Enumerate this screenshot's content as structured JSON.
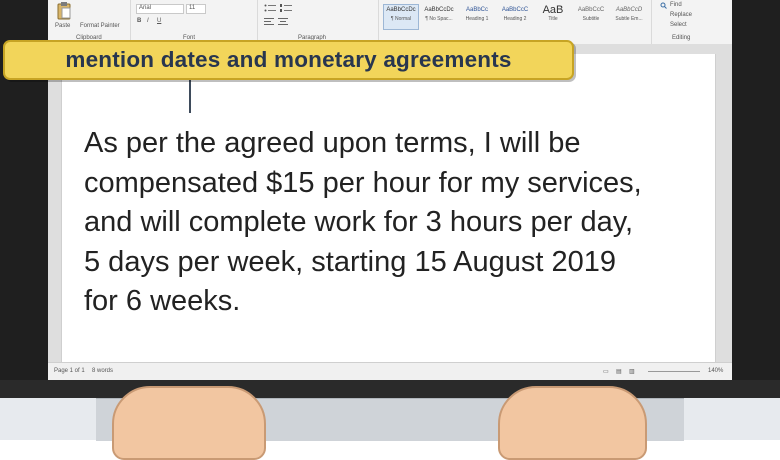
{
  "annotation": {
    "text": "mention dates and monetary agreements"
  },
  "document": {
    "body_lines": [
      "As per the agreed upon terms, I will be",
      "compensated $15 per hour for my services,",
      "and will complete work for 3 hours per day,",
      "5 days per week, starting 15 August 2019",
      "for 6 weeks."
    ]
  },
  "ribbon": {
    "clipboard": {
      "paste": "Paste",
      "format_painter": "Format Painter",
      "group": "Clipboard"
    },
    "font": {
      "name": "Arial",
      "size": "11",
      "group": "Font"
    },
    "paragraph": {
      "group": "Paragraph"
    },
    "styles": [
      {
        "sample": "AaBbCcDc",
        "name": "¶ Normal"
      },
      {
        "sample": "AaBbCcDc",
        "name": "¶ No Spac..."
      },
      {
        "sample": "AaBbCc",
        "name": "Heading 1"
      },
      {
        "sample": "AaBbCcC",
        "name": "Heading 2"
      },
      {
        "sample": "AaB",
        "name": "Title"
      },
      {
        "sample": "AaBbCcC",
        "name": "Subtitle"
      },
      {
        "sample": "AaBbCcD",
        "name": "Subtle Em..."
      }
    ],
    "editing": {
      "find": "Find",
      "replace": "Replace",
      "select": "Select",
      "group": "Editing"
    }
  },
  "statusbar": {
    "page": "Page 1 of 1",
    "words": "8 words",
    "zoom": "140%"
  },
  "colors": {
    "callout_fill": "#f2d55a",
    "callout_text": "#28364f",
    "bezel": "#1f1f1f",
    "document_text": "#222222"
  }
}
